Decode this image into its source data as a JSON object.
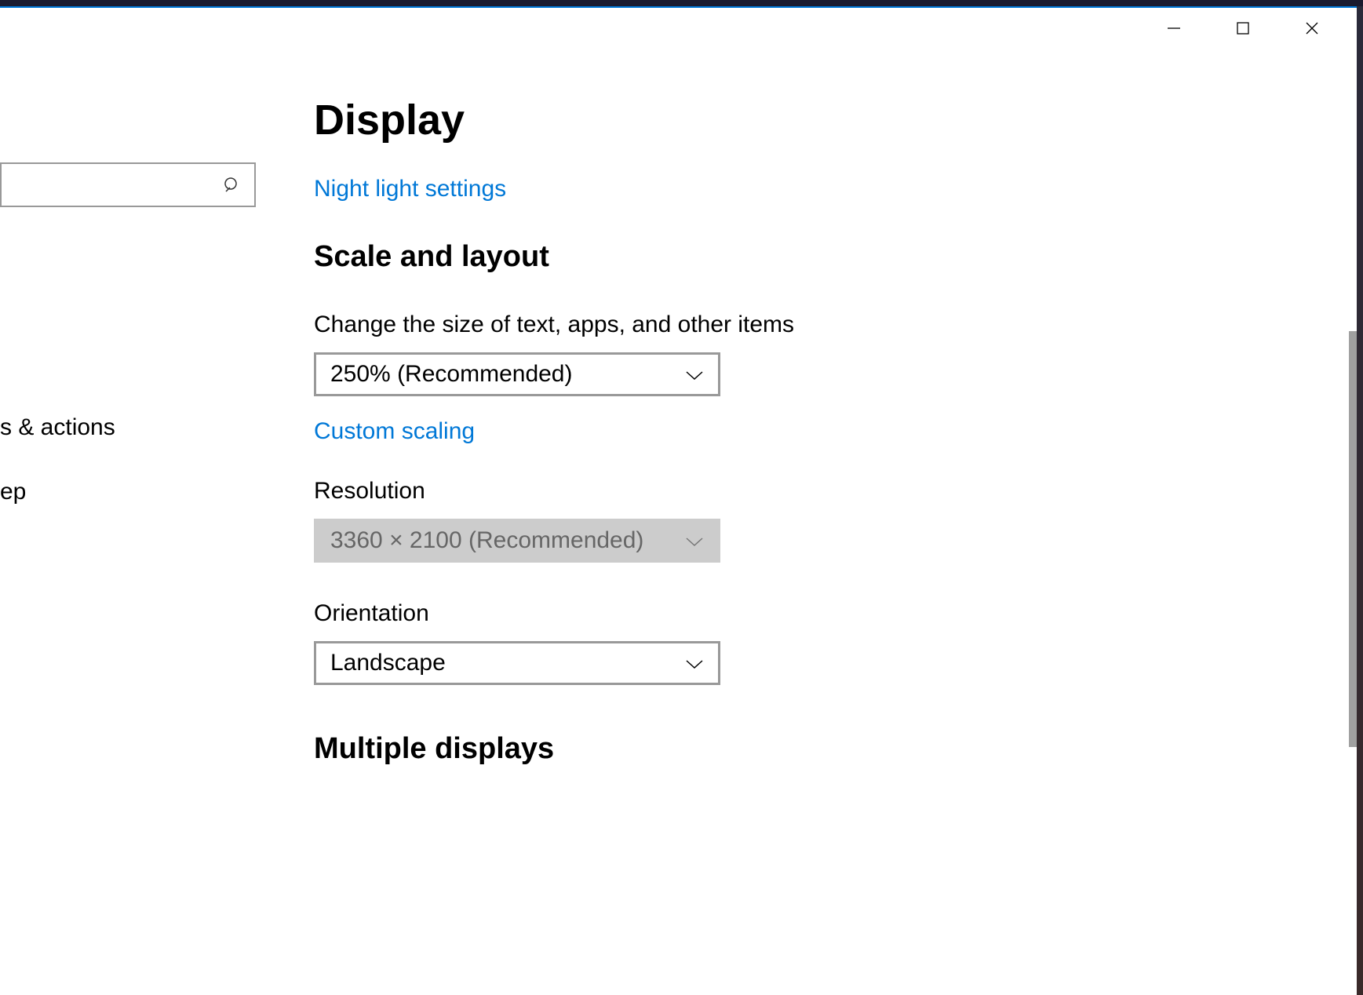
{
  "titlebar": {
    "minimize": "Minimize",
    "maximize": "Maximize",
    "close": "Close"
  },
  "sidebar": {
    "search_placeholder": "",
    "items": [
      {
        "label": "s & actions"
      },
      {
        "label": "ep"
      }
    ]
  },
  "main": {
    "title": "Display",
    "night_light_link": "Night light settings",
    "scale_section_title": "Scale and layout",
    "scale_label": "Change the size of text, apps, and other items",
    "scale_value": "250% (Recommended)",
    "custom_scaling_link": "Custom scaling",
    "resolution_label": "Resolution",
    "resolution_value": "3360 × 2100 (Recommended)",
    "orientation_label": "Orientation",
    "orientation_value": "Landscape",
    "multiple_displays_title": "Multiple displays"
  }
}
